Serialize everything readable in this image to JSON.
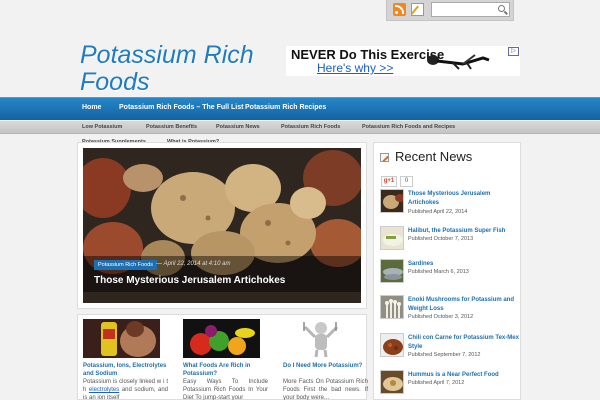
{
  "header": {
    "site_title": "Potassium Rich Foods",
    "search_placeholder": ""
  },
  "ad": {
    "title": "NEVER Do This Exercise",
    "link": "Here's why >>"
  },
  "nav": {
    "items": [
      "Home",
      "Potassium Rich Foods – The Full List",
      "Potassium Rich Recipes"
    ]
  },
  "subnav": {
    "row1": [
      "Low Potassium",
      "Potassium Benefits",
      "Potassium News",
      "Potassium Rich Foods",
      "Potassium Rich Foods and Recipes"
    ],
    "row2": [
      "Potassium Supplements",
      "What is Potassium?"
    ]
  },
  "slider": {
    "category": "Potassium Rich Foods",
    "date": "— April 22, 2014 at 4:10 am",
    "title": "Those Mysterious Jerusalem Artichokes"
  },
  "cards": [
    {
      "title": "Potassium, Ions, Electrolytes and Sodium",
      "text_before": "Potassium is closely linked w i t h ",
      "link": "electrolytes",
      "text_after": " and sodium, and is an ion itself"
    },
    {
      "title": "What Foods Are Rich in Potassium?",
      "text": "Easy Ways To Include Potassium Rich Foods In Your Diet To jump-start your"
    },
    {
      "title": "Do I Need More Potassium?",
      "text": "More Facts On Potassium Rich Foods First the bad news. If your body were..."
    }
  ],
  "sidebar": {
    "title": "Recent News",
    "gplus_label": "g+1",
    "gplus_count": "0",
    "posts": [
      {
        "title": "Those Mysterious Jerusalem Artichokes",
        "date": "Published April 22, 2014"
      },
      {
        "title": "Halibut, the Potassium Super Fish",
        "date": "Published October 7, 2013"
      },
      {
        "title": "Sardines",
        "date": "Published March 6, 2013"
      },
      {
        "title": "Enoki Mushrooms for Potassium and Weight Loss",
        "date": "Published October 3, 2012"
      },
      {
        "title": "Chili con Carne for Potassium Tex-Mex Style",
        "date": "Published September 7, 2012"
      },
      {
        "title": "Hummus is a Near Perfect Food",
        "date": "Published April 7, 2012"
      }
    ]
  },
  "colors": {
    "brand_blue": "#1d7cc4",
    "nav_blue": "#1462a0",
    "link_blue": "#1d6fb0"
  }
}
